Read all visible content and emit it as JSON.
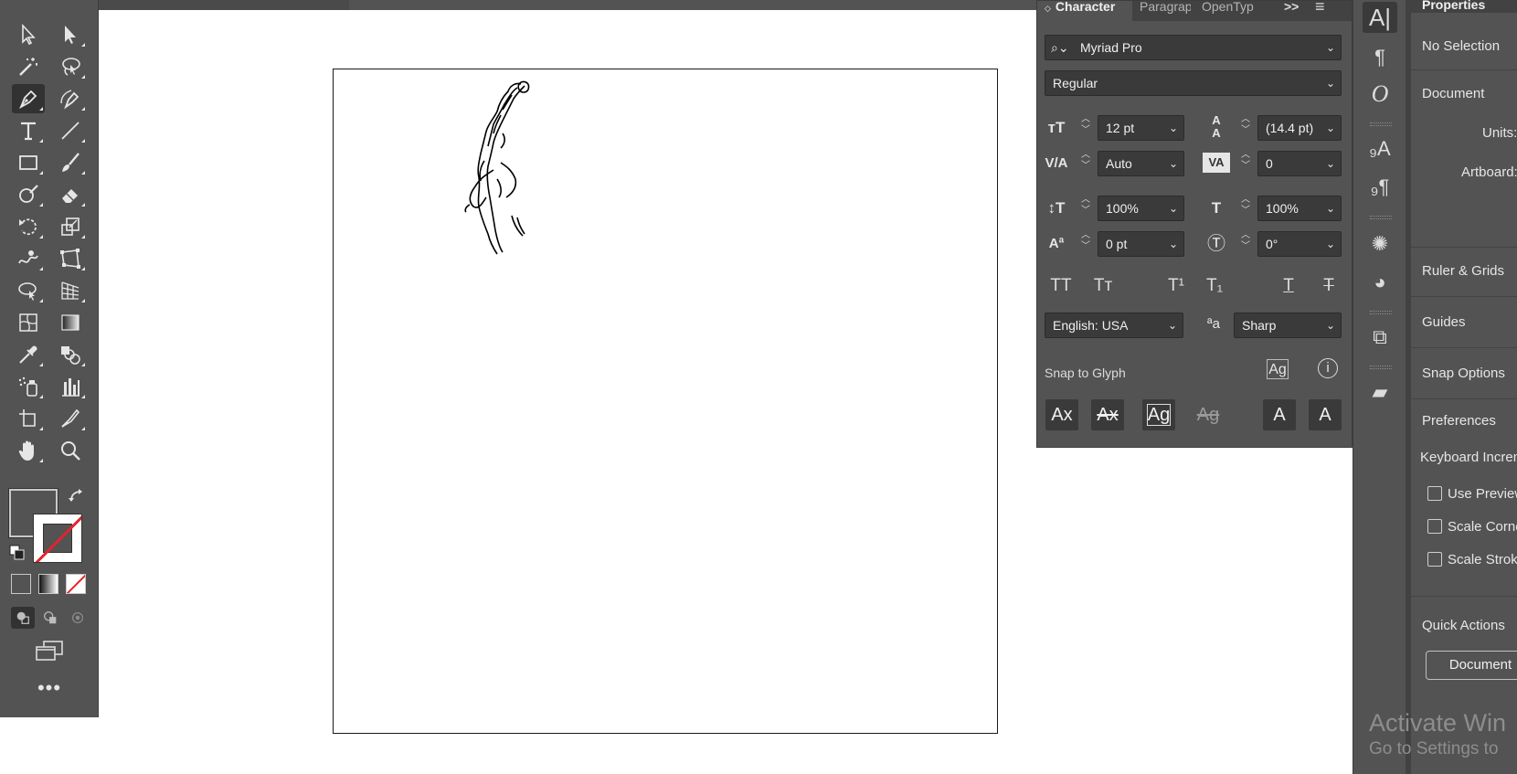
{
  "character_panel": {
    "tabs": [
      "Character",
      "Paragrap",
      "OpenTyp"
    ],
    "overflow": ">>",
    "font_family": "Myriad Pro",
    "font_style": "Regular",
    "font_size": "12 pt",
    "leading": "(14.4 pt)",
    "kerning": "Auto",
    "tracking": "0",
    "vertical_scale": "100%",
    "horizontal_scale": "100%",
    "baseline_shift": "0 pt",
    "rotation": "0°",
    "language": "English: USA",
    "antialias": "Sharp",
    "snap_label": "Snap to Glyph",
    "style_buttons": [
      "TT",
      "Tт",
      "T¹",
      "T₁",
      "T",
      "T"
    ],
    "snap_buttons": [
      "Ax",
      "Ax",
      "Ag",
      "Ag",
      "A",
      "A"
    ]
  },
  "properties_panel": {
    "tab": "Properties",
    "no_selection": "No Selection",
    "document": "Document",
    "units": "Units:",
    "artboard": "Artboard:",
    "ruler_grids": "Ruler & Grids",
    "guides": "Guides",
    "snap_options": "Snap Options",
    "preferences": "Preferences",
    "keyboard_increment": "Keyboard Increm",
    "use_preview": "Use Preview",
    "scale_corners": "Scale Corne",
    "scale_strokes": "Scale Stroke",
    "quick_actions": "Quick Actions",
    "document_button": "Document"
  },
  "watermark": {
    "line1": "Activate Win",
    "line2": "Go to Settings to"
  },
  "toolbar": {
    "more": "•••"
  },
  "colors": {
    "panel_bg": "#535353",
    "panel_dark": "#3a3a3a",
    "canvas": "#ffffff",
    "stroke_none": "#e3242b"
  }
}
